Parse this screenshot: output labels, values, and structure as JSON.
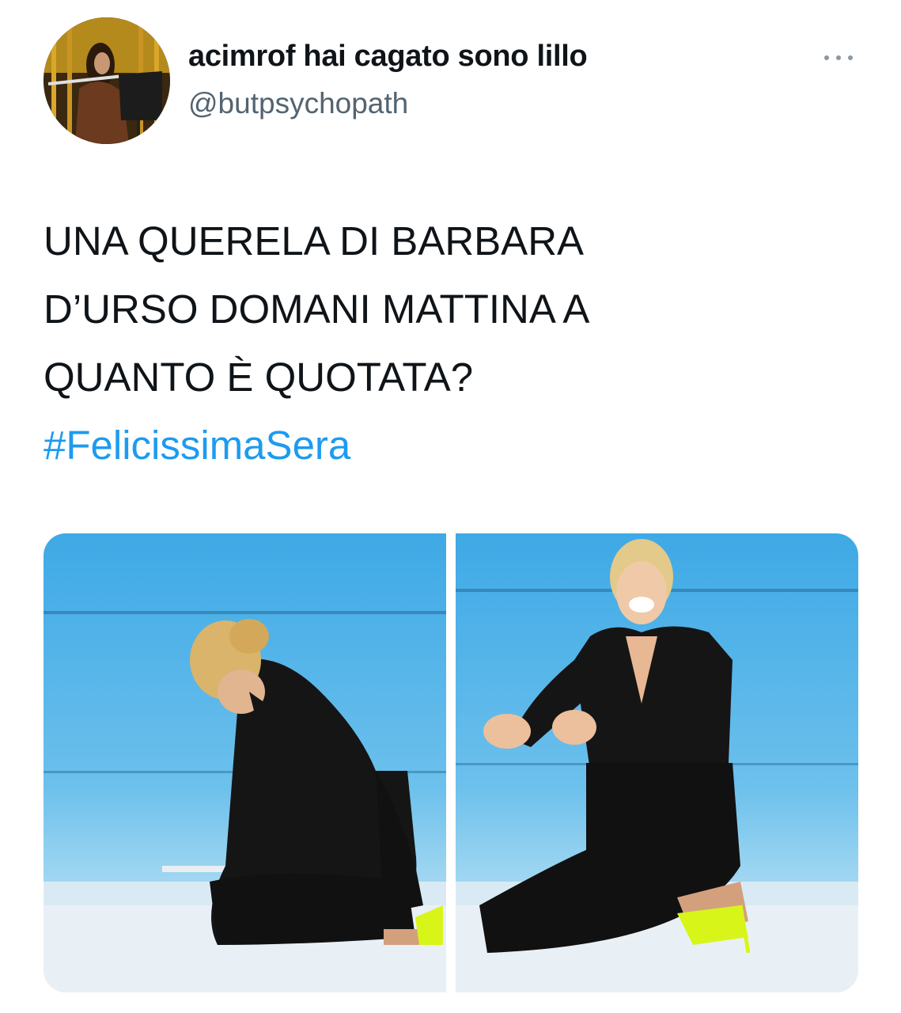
{
  "author": {
    "display_name": "acimrof hai cagato sono lillo",
    "handle": "@butpsychopath",
    "avatar_icon": "avatar-photo"
  },
  "header": {
    "more_icon": "ellipsis-icon"
  },
  "tweet": {
    "lines": [
      "UNA QUERELA DI BARBARA",
      "D’URSO DOMANI MATTINA A",
      "QUANTO È QUOTATA?"
    ],
    "hashtag": "#FelicissimaSera"
  },
  "media": {
    "count": 2,
    "colors": {
      "studio_blue": "#3aa5e0",
      "dress": "#151515",
      "shoes": "#d8f51a",
      "hashtag": "#1d9bf0"
    }
  }
}
